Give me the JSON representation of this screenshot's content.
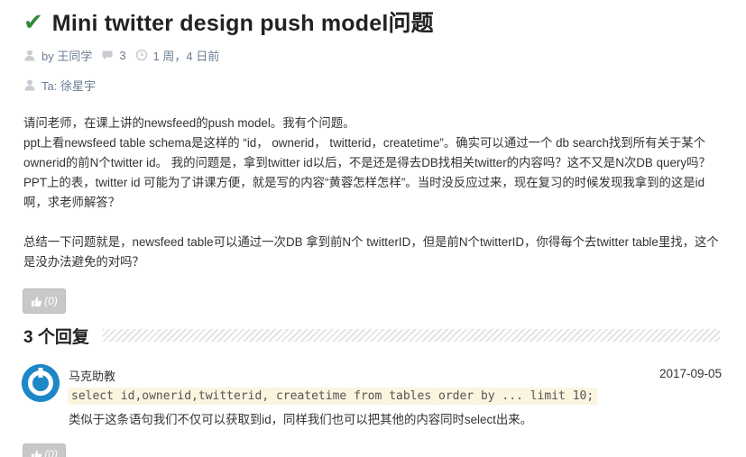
{
  "post": {
    "title": "Mini twitter design push model问题",
    "author": "by 王同学",
    "reply_count": "3",
    "time_ago": "1 周，4 日前",
    "ta": "Ta: 徐星宇",
    "body": [
      "请问老师，在课上讲的newsfeed的push model。我有个问题。",
      "ppt上看newsfeed table schema是这样的 “id， ownerid， twitterid，createtime”。确实可以通过一个 db search找到所有关于某个ownerid的前N个twitter id。 我的问题是，拿到twitter id以后，不是还是得去DB找相关twitter的内容吗？这不又是N次DB query吗？PPT上的表，twitter id 可能为了讲课方便，就是写的内容“黄蓉怎样怎样”。当时没反应过来，现在复习的时候发现我拿到的这是id啊，求老师解答？",
      "总结一下问题就是，newsfeed table可以通过一次DB 拿到前N个 twitterID，但是前N个twitterID，你得每个去twitter table里找，这个是没办法避免的对吗？"
    ],
    "like_label": "(0)"
  },
  "replies_section": {
    "title": "3 个回复"
  },
  "replies": [
    {
      "author": "马克助教",
      "date": "2017-09-05",
      "code": "select id,ownerid,twitterid, createtime from tables order by ... limit 10;",
      "text": "类似于这条语句我们不仅可以获取到id，同样我们也可以把其他的内容同时select出来。",
      "like_label": "(0)"
    }
  ],
  "icons": {
    "title": "check-icon",
    "author": "user-icon",
    "comments": "comment-icon",
    "time": "clock-icon",
    "ta": "user-icon",
    "like": "thumbs-up-icon",
    "avatar": "avatar-icon"
  },
  "colors": {
    "check": "#2e8b3a",
    "meta_text": "#6a7d95",
    "avatar": "#1e87c8",
    "code_bg": "#fbf4df",
    "like_button": "#c8c8c8"
  }
}
